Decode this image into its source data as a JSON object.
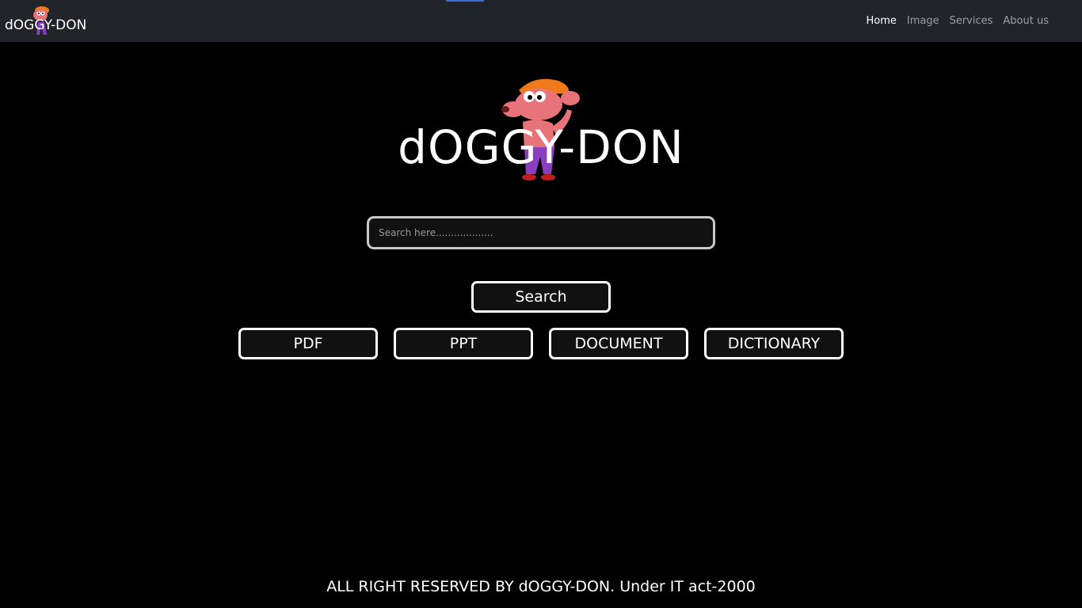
{
  "header": {
    "brand": "dOGGY-DON",
    "nav": [
      {
        "label": "Home",
        "active": true
      },
      {
        "label": "Image",
        "active": false
      },
      {
        "label": "Services",
        "active": false
      },
      {
        "label": "About us",
        "active": false
      }
    ]
  },
  "hero": {
    "title": "dOGGY-DON"
  },
  "search": {
    "placeholder": "Search here...................",
    "value": "",
    "button_label": "Search"
  },
  "categories": [
    {
      "label": "PDF"
    },
    {
      "label": "PPT"
    },
    {
      "label": "DOCUMENT"
    },
    {
      "label": "DICTIONARY"
    }
  ],
  "footer": {
    "text": "ALL RIGHT RESERVED BY dOGGY-DON. Under IT act-2000"
  },
  "colors": {
    "navbar_bg": "#212529",
    "page_bg": "#000000",
    "accent_strip": "#3b6fd6"
  }
}
